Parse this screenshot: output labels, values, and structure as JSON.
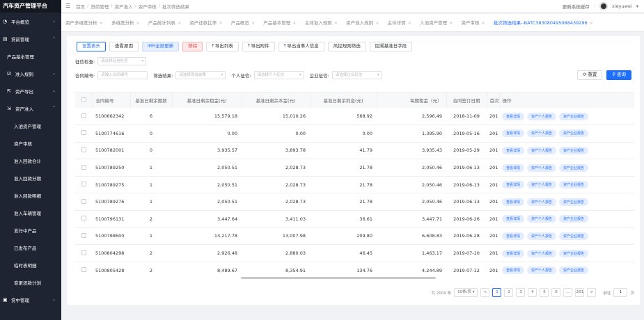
{
  "app": {
    "title": "汽车资产管理平台"
  },
  "sidebar": {
    "items": [
      {
        "label": "平台概览",
        "icon": "dashboard-icon",
        "level": 0,
        "chev": "v"
      },
      {
        "label": "贷前管理",
        "icon": "list-icon",
        "level": 0,
        "chev": "^"
      },
      {
        "label": "产品基本管理",
        "icon": "",
        "level": 1,
        "chev": ""
      },
      {
        "label": "准入规则",
        "icon": "checkbox-icon",
        "level": 1,
        "chev": "v"
      },
      {
        "label": "资产导出",
        "icon": "export-icon",
        "level": 1,
        "chev": "v"
      },
      {
        "label": "资产准入",
        "icon": "import-icon",
        "level": 1,
        "chev": "^"
      },
      {
        "label": "入池资产管理",
        "icon": "",
        "level": 2,
        "chev": ""
      },
      {
        "label": "资产审核",
        "icon": "",
        "level": 2,
        "chev": ""
      },
      {
        "label": "准入回款合计",
        "icon": "",
        "level": 2,
        "chev": ""
      },
      {
        "label": "准入回款分期",
        "icon": "",
        "level": 2,
        "chev": ""
      },
      {
        "label": "准入回款明细",
        "icon": "",
        "level": 2,
        "chev": ""
      },
      {
        "label": "准入车辆管理",
        "icon": "",
        "level": 2,
        "chev": ""
      },
      {
        "label": "发行中产品",
        "icon": "",
        "level": 2,
        "chev": ""
      },
      {
        "label": "已发布产品",
        "icon": "",
        "level": 2,
        "chev": ""
      },
      {
        "label": "临时表明细",
        "icon": "",
        "level": 2,
        "chev": ""
      },
      {
        "label": "变更还款计划",
        "icon": "",
        "level": 2,
        "chev": ""
      },
      {
        "label": "贷中管理",
        "icon": "monitor-icon",
        "level": 0,
        "chev": "v"
      }
    ]
  },
  "header": {
    "breadcrumb": [
      "首页",
      "贷前管理",
      "资产准入",
      "资产审核",
      "批次筛选结果"
    ],
    "right_link": "更新系统缓存",
    "user": "xieyuwei"
  },
  "tabs": [
    {
      "label": "资产多维度分析",
      "active": false
    },
    {
      "label": "多维度分析",
      "active": false
    },
    {
      "label": "产品统计列表",
      "active": false
    },
    {
      "label": "资产还款比率",
      "active": false
    },
    {
      "label": "产品概览",
      "active": false
    },
    {
      "label": "产品基本管理",
      "active": false
    },
    {
      "label": "主体准入规则",
      "active": false
    },
    {
      "label": "资产准入规则",
      "active": false
    },
    {
      "label": "主体详情",
      "active": false
    },
    {
      "label": "入池资产管理",
      "active": false
    },
    {
      "label": "资产审核",
      "active": false
    },
    {
      "label": "批次筛选结果--BATC383080495088439296",
      "active": true
    }
  ],
  "toolbar": {
    "buttons": [
      "设置表头",
      "查看原因",
      "IRR全部更新",
      "移除",
      "导出列表",
      "导出附件",
      "导出当事人信息",
      "风控规则筛选",
      "回溯基准日字段"
    ]
  },
  "filters": {
    "credit_check_label": "征信检查:",
    "credit_check_placeholder": "请选择征信检查",
    "contract_no_label": "合同编号:",
    "contract_no_placeholder": "请输入合同编号",
    "screen_result_label": "筛选结果:",
    "screen_result_placeholder": "请选择筛选结果",
    "personal_credit_label": "个人征信:",
    "personal_credit_placeholder": "请选择个人征信",
    "company_credit_label": "企业征信:",
    "company_credit_placeholder": "请选择企业征信",
    "reset_label": "重置",
    "search_label": "查询"
  },
  "table": {
    "headers": [
      "合同编号",
      "基准日剩余期数",
      "基准日剩余租金(元)",
      "基准日剩余本金(元)",
      "基准日剩余利息(元)",
      "每期租金（元）",
      "合同签订日期",
      "首次",
      "操作"
    ],
    "actions": [
      "查看详情",
      "资产个人报告",
      "资产企业报告"
    ],
    "rows": [
      [
        "5100662342",
        "6",
        "15,579.18",
        "15,010.26",
        "568.92",
        "2,596.49",
        "2018-11-09",
        "201"
      ],
      [
        "5100774616",
        "0",
        "0.00",
        "0.00",
        "0.00",
        "1,395.90",
        "2019-05-16",
        "201"
      ],
      [
        "5100782001",
        "0",
        "3,935.57",
        "3,893.78",
        "41.79",
        "3,935.43",
        "2019-05-29",
        "201"
      ],
      [
        "5100789250",
        "1",
        "2,050.51",
        "2,028.73",
        "21.78",
        "2,050.46",
        "2019-06-13",
        "201"
      ],
      [
        "5100789275",
        "1",
        "2,050.51",
        "2,028.73",
        "21.78",
        "2,050.46",
        "2019-06-13",
        "201"
      ],
      [
        "5100789276",
        "1",
        "2,050.51",
        "2,028.73",
        "21.78",
        "2,050.46",
        "2019-06-13",
        "201"
      ],
      [
        "5100796131",
        "2",
        "3,447.64",
        "3,411.03",
        "36.61",
        "3,447.71",
        "2019-06-26",
        "201"
      ],
      [
        "5100798600",
        "1",
        "13,217.78",
        "13,007.98",
        "209.80",
        "6,608.83",
        "2019-06-28",
        "201"
      ],
      [
        "5100804298",
        "2",
        "2,926.48",
        "2,880.03",
        "46.45",
        "1,463.17",
        "2019-07-10",
        "201"
      ],
      [
        "5100805428",
        "2",
        "8,489.67",
        "8,354.91",
        "134.76",
        "4,244.89",
        "2019-07-12",
        "201"
      ]
    ]
  },
  "pagination": {
    "total": "共 2009 条",
    "page_size": "10条/页",
    "prev": "<",
    "pages": [
      "1",
      "2",
      "3",
      "4",
      "5",
      "6",
      "...",
      "201"
    ],
    "next": ">",
    "goto_label": "前往",
    "goto_value": "1",
    "page_suffix": "页"
  }
}
